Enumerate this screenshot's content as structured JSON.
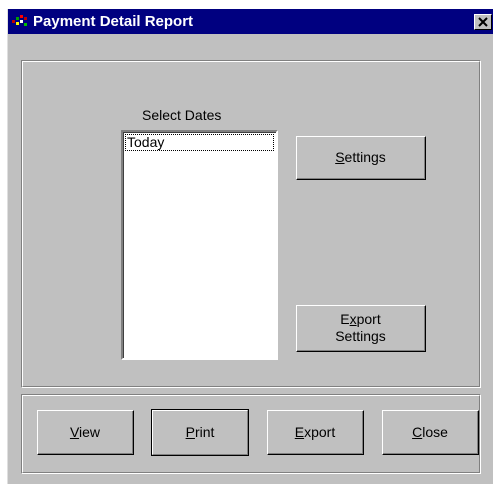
{
  "window": {
    "title": "Payment Detail Report",
    "close_glyph": "×",
    "icon": "app-report-icon"
  },
  "dates": {
    "label": "Select Dates",
    "items": [
      "Today"
    ],
    "selected": "Today"
  },
  "side_buttons": {
    "settings": {
      "mnemonic": "S",
      "rest": "ettings"
    },
    "export_settings": {
      "line1_pre": "E",
      "line1_mnemonic": "x",
      "line1_post": "port",
      "line2": "Settings"
    }
  },
  "bottom_buttons": {
    "view": {
      "mnemonic": "V",
      "rest": "iew"
    },
    "print": {
      "mnemonic": "P",
      "rest": "rint"
    },
    "export": {
      "mnemonic": "E",
      "rest": "xport"
    },
    "close": {
      "mnemonic": "C",
      "rest": "lose"
    }
  },
  "colors": {
    "titlebar": "#000080",
    "face": "#c0c0c0"
  }
}
